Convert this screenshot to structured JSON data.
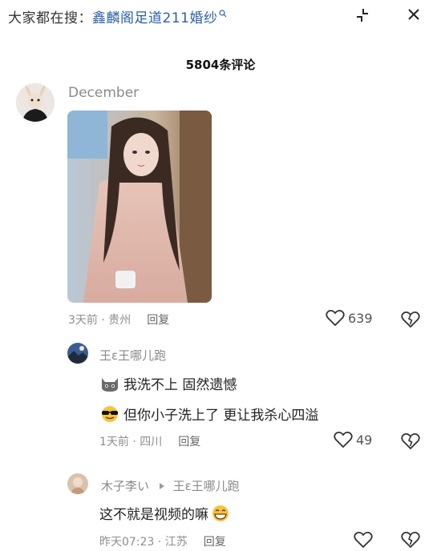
{
  "header": {
    "search_prefix": "大家都在搜：",
    "search_term": "鑫麟阁足道211婚纱"
  },
  "comments_header": {
    "count_text": "5804条评论"
  },
  "comment": {
    "username": "December",
    "time_location": "3天前 · 贵州",
    "reply_label": "回复",
    "like_count": "639"
  },
  "replies": [
    {
      "username": "王ε王哪儿跑",
      "lines": [
        "我洗不上  固然遗憾",
        "但你小子洗上了  更让我杀心四溢"
      ],
      "time_location": "1天前 · 四川",
      "reply_label": "回复",
      "like_count": "49"
    },
    {
      "username": "木子李い",
      "reply_to": "王ε王哪儿跑",
      "text": "这不就是视频的嘛",
      "time_location": "昨天07:23 · 江苏",
      "reply_label": "回复",
      "like_count": ""
    }
  ]
}
